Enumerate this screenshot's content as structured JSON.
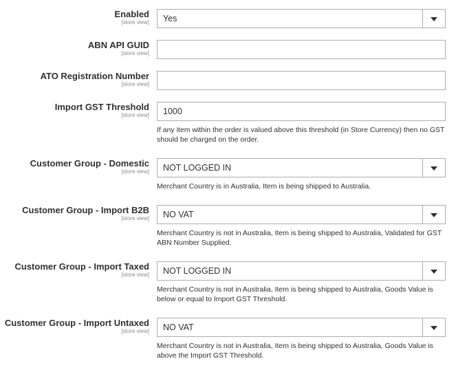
{
  "fields": [
    {
      "label": "Enabled",
      "scope": "[store view]",
      "type": "select",
      "value": "Yes",
      "note": ""
    },
    {
      "label": "ABN API GUID",
      "scope": "[store view]",
      "type": "text",
      "value": "",
      "note": ""
    },
    {
      "label": "ATO Registration Number",
      "scope": "[store view]",
      "type": "text",
      "value": "",
      "note": ""
    },
    {
      "label": "Import GST Threshold",
      "scope": "[store view]",
      "type": "text",
      "value": "1000",
      "note": "If any item within the order is valued above this threshold (in Store Currency) then no GST should be charged on the order."
    },
    {
      "label": "Customer Group - Domestic",
      "scope": "[store view]",
      "type": "select",
      "value": "NOT LOGGED IN",
      "note": "Merchant Country is in Australia, Item is being shipped to Australia."
    },
    {
      "label": "Customer Group - Import B2B",
      "scope": "[store view]",
      "type": "select",
      "value": "NO VAT",
      "note": "Merchant Country is not in Australia, Item is being shipped to Australia, Validated for GST ABN Number Supplied."
    },
    {
      "label": "Customer Group - Import Taxed",
      "scope": "[store view]",
      "type": "select",
      "value": "NOT LOGGED IN",
      "note": "Merchant Country is not in Australia, Item is being shipped to Australia, Goods Value is below or equal to Import GST Threshold."
    },
    {
      "label": "Customer Group - Import Untaxed",
      "scope": "[store view]",
      "type": "select",
      "value": "NO VAT",
      "note": "Merchant Country is not in Australia, Item is being shipped to Australia, Goods Value is above the Import GST Threshold."
    }
  ],
  "icons": {
    "select_arrow": "chevron-down-icon"
  },
  "colors": {
    "border": "#adadad",
    "text": "#303030",
    "scope": "#8a8a8a"
  }
}
